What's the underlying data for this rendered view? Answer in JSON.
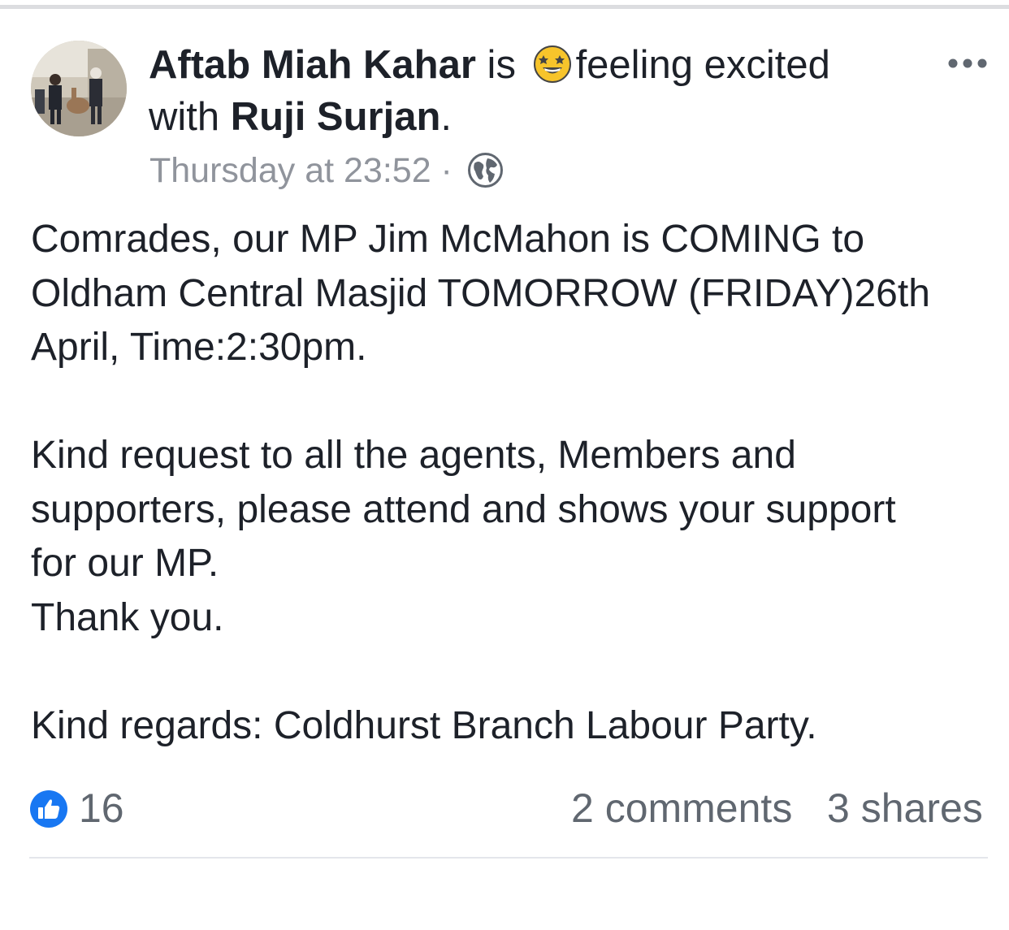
{
  "post": {
    "author": "Aftab Miah Kahar",
    "is_text": " is ",
    "feeling_text": "feeling excited",
    "with_text": "with ",
    "tagged": "Ruji Surjan",
    "tagged_suffix": ".",
    "timestamp": "Thursday at 23:52",
    "separator": " · ",
    "privacy_icon": "globe-icon",
    "feeling_icon": "star-struck-emoji-icon",
    "options_icon": "more-horizontal-icon",
    "body_lines": [
      "Comrades, our MP Jim McMahon is COMING to",
      "Oldham Central Masjid TOMORROW (FRIDAY)26th",
      "April, Time:2:30pm.",
      "",
      "Kind request to all the agents, Members and",
      "supporters, please attend and shows your support",
      "for our MP.",
      "Thank you.",
      "",
      "Kind regards: Coldhurst Branch Labour Party."
    ]
  },
  "footer": {
    "like_icon": "like-thumb-icon",
    "like_count": "16",
    "comments": "2 comments",
    "shares": "3 shares"
  },
  "colors": {
    "text": "#1d2129",
    "secondary": "#90949c",
    "like_blue": "#1877f2",
    "divider": "#e4e6eb"
  }
}
